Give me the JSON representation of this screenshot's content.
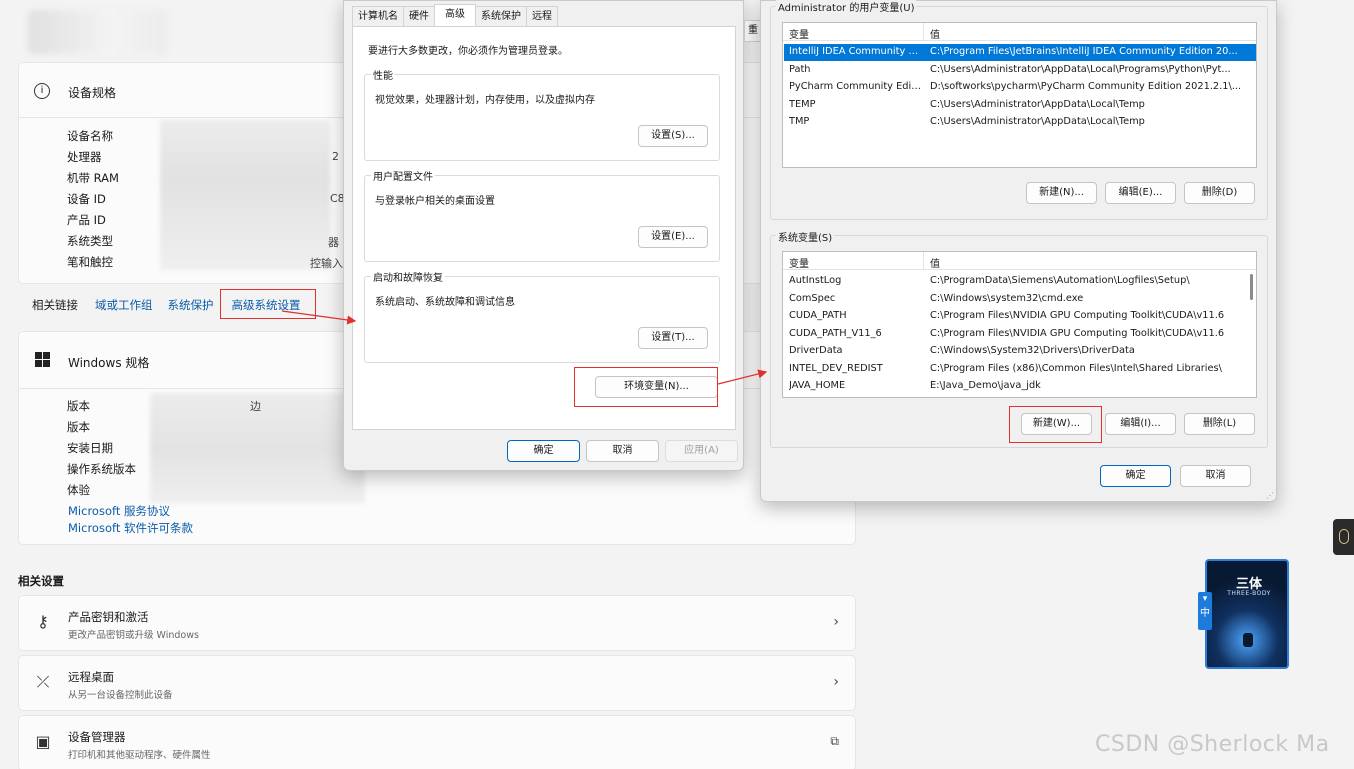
{
  "settings": {
    "device_spec": {
      "title": "设备规格",
      "labels": [
        "设备名称",
        "处理器",
        "机带 RAM",
        "设备 ID",
        "产品 ID",
        "系统类型",
        "笔和触控"
      ],
      "partial_values": [
        "2",
        "C80",
        "器",
        "控输入"
      ]
    },
    "related_links": {
      "label": "相关链接",
      "items": [
        "域或工作组",
        "系统保护",
        "高级系统设置"
      ]
    },
    "windows_spec": {
      "title": "Windows 规格",
      "labels": [
        "版本",
        "版本",
        "安装日期",
        "操作系统版本",
        "体验"
      ],
      "partial_value": "边",
      "links": [
        "Microsoft 服务协议",
        "Microsoft 软件许可条款"
      ]
    },
    "related_settings": {
      "title": "相关设置",
      "rows": [
        {
          "title": "产品密钥和激活",
          "subtitle": "更改产品密钥或升级 Windows",
          "icon": "key-icon"
        },
        {
          "title": "远程桌面",
          "subtitle": "从另一台设备控制此设备",
          "icon": "remote-desktop-icon"
        },
        {
          "title": "设备管理器",
          "subtitle": "打印机和其他驱动程序、硬件属性",
          "icon": "device-manager-icon"
        }
      ]
    }
  },
  "system_properties": {
    "tabs": [
      "计算机名",
      "硬件",
      "高级",
      "系统保护",
      "远程"
    ],
    "active_tab": "高级",
    "admin_note": "要进行大多数更改，你必须作为管理员登录。",
    "groups": [
      {
        "title": "性能",
        "desc": "视觉效果，处理器计划，内存使用，以及虚拟内存",
        "button": "设置(S)..."
      },
      {
        "title": "用户配置文件",
        "desc": "与登录帐户相关的桌面设置",
        "button": "设置(E)..."
      },
      {
        "title": "启动和故障恢复",
        "desc": "系统启动、系统故障和调试信息",
        "button": "设置(T)..."
      }
    ],
    "env_button": "环境变量(N)...",
    "ok": "确定",
    "cancel": "取消",
    "apply": "应用(A)",
    "side_tab": "重"
  },
  "env_vars": {
    "user_title": "Administrator 的用户变量(U)",
    "col_var": "变量",
    "col_val": "值",
    "user_vars": [
      {
        "name": "IntelliJ IDEA Community E...",
        "value": "C:\\Program Files\\JetBrains\\IntelliJ IDEA Community Edition 20...",
        "selected": true
      },
      {
        "name": "Path",
        "value": "C:\\Users\\Administrator\\AppData\\Local\\Programs\\Python\\Pyt..."
      },
      {
        "name": "PyCharm Community Editi...",
        "value": "D:\\softworks\\pycharm\\PyCharm Community Edition 2021.2.1\\..."
      },
      {
        "name": "TEMP",
        "value": "C:\\Users\\Administrator\\AppData\\Local\\Temp"
      },
      {
        "name": "TMP",
        "value": "C:\\Users\\Administrator\\AppData\\Local\\Temp"
      }
    ],
    "user_buttons": [
      "新建(N)...",
      "编辑(E)...",
      "删除(D)"
    ],
    "sys_title": "系统变量(S)",
    "sys_vars": [
      {
        "name": "AutInstLog",
        "value": "C:\\ProgramData\\Siemens\\Automation\\Logfiles\\Setup\\"
      },
      {
        "name": "ComSpec",
        "value": "C:\\Windows\\system32\\cmd.exe"
      },
      {
        "name": "CUDA_PATH",
        "value": "C:\\Program Files\\NVIDIA GPU Computing Toolkit\\CUDA\\v11.6"
      },
      {
        "name": "CUDA_PATH_V11_6",
        "value": "C:\\Program Files\\NVIDIA GPU Computing Toolkit\\CUDA\\v11.6"
      },
      {
        "name": "DriverData",
        "value": "C:\\Windows\\System32\\Drivers\\DriverData"
      },
      {
        "name": "INTEL_DEV_REDIST",
        "value": "C:\\Program Files (x86)\\Common Files\\Intel\\Shared Libraries\\"
      },
      {
        "name": "JAVA_HOME",
        "value": "E:\\Java_Demo\\java_jdk"
      }
    ],
    "sys_buttons": [
      "新建(W)...",
      "编辑(I)...",
      "删除(L)"
    ],
    "ok": "确定",
    "cancel": "取消"
  },
  "widgets": {
    "book_title": "三体",
    "book_subtitle": "THREE-BODY",
    "book_tag": "中"
  },
  "watermark": "CSDN @Sherlock  Ma",
  "colors": {
    "accent": "#0067c0",
    "selection": "#0078d7",
    "annotation": "#e03030",
    "link": "#0a5cab"
  }
}
